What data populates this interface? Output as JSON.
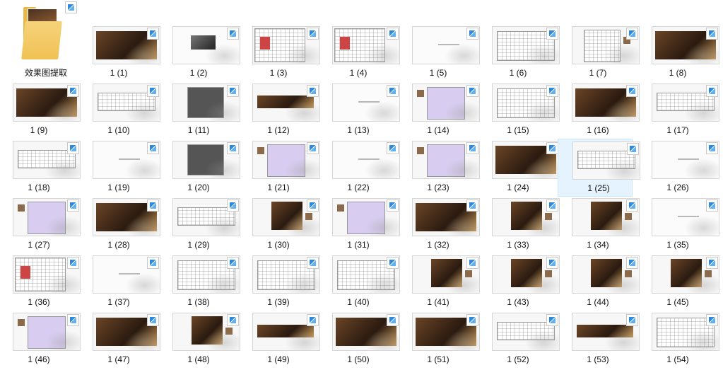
{
  "folder": {
    "name": "效果图提取",
    "icon": "folder-icon"
  },
  "items": [
    "1 (1)",
    "1 (2)",
    "1 (3)",
    "1 (4)",
    "1 (5)",
    "1 (6)",
    "1 (7)",
    "1 (8)",
    "1 (9)",
    "1 (10)",
    "1 (11)",
    "1 (12)",
    "1 (13)",
    "1 (14)",
    "1 (15)",
    "1 (16)",
    "1 (17)",
    "1 (18)",
    "1 (19)",
    "1 (20)",
    "1 (21)",
    "1 (22)",
    "1 (23)",
    "1 (24)",
    "1 (25)",
    "1 (26)",
    "1 (27)",
    "1 (28)",
    "1 (29)",
    "1 (30)",
    "1 (31)",
    "1 (32)",
    "1 (33)",
    "1 (34)",
    "1 (35)",
    "1 (36)",
    "1 (37)",
    "1 (38)",
    "1 (39)",
    "1 (40)",
    "1 (41)",
    "1 (43)",
    "1 (44)",
    "1 (45)",
    "1 (46)",
    "1 (47)",
    "1 (48)",
    "1 (49)",
    "1 (50)",
    "1 (51)",
    "1 (52)",
    "1 (53)",
    "1 (54)"
  ],
  "selected_item": "1 (25)",
  "colors": {
    "selection_bg": "#e5f3ff",
    "shortcut_arrow": "#2b8ae0",
    "folder": "#f0c254"
  }
}
